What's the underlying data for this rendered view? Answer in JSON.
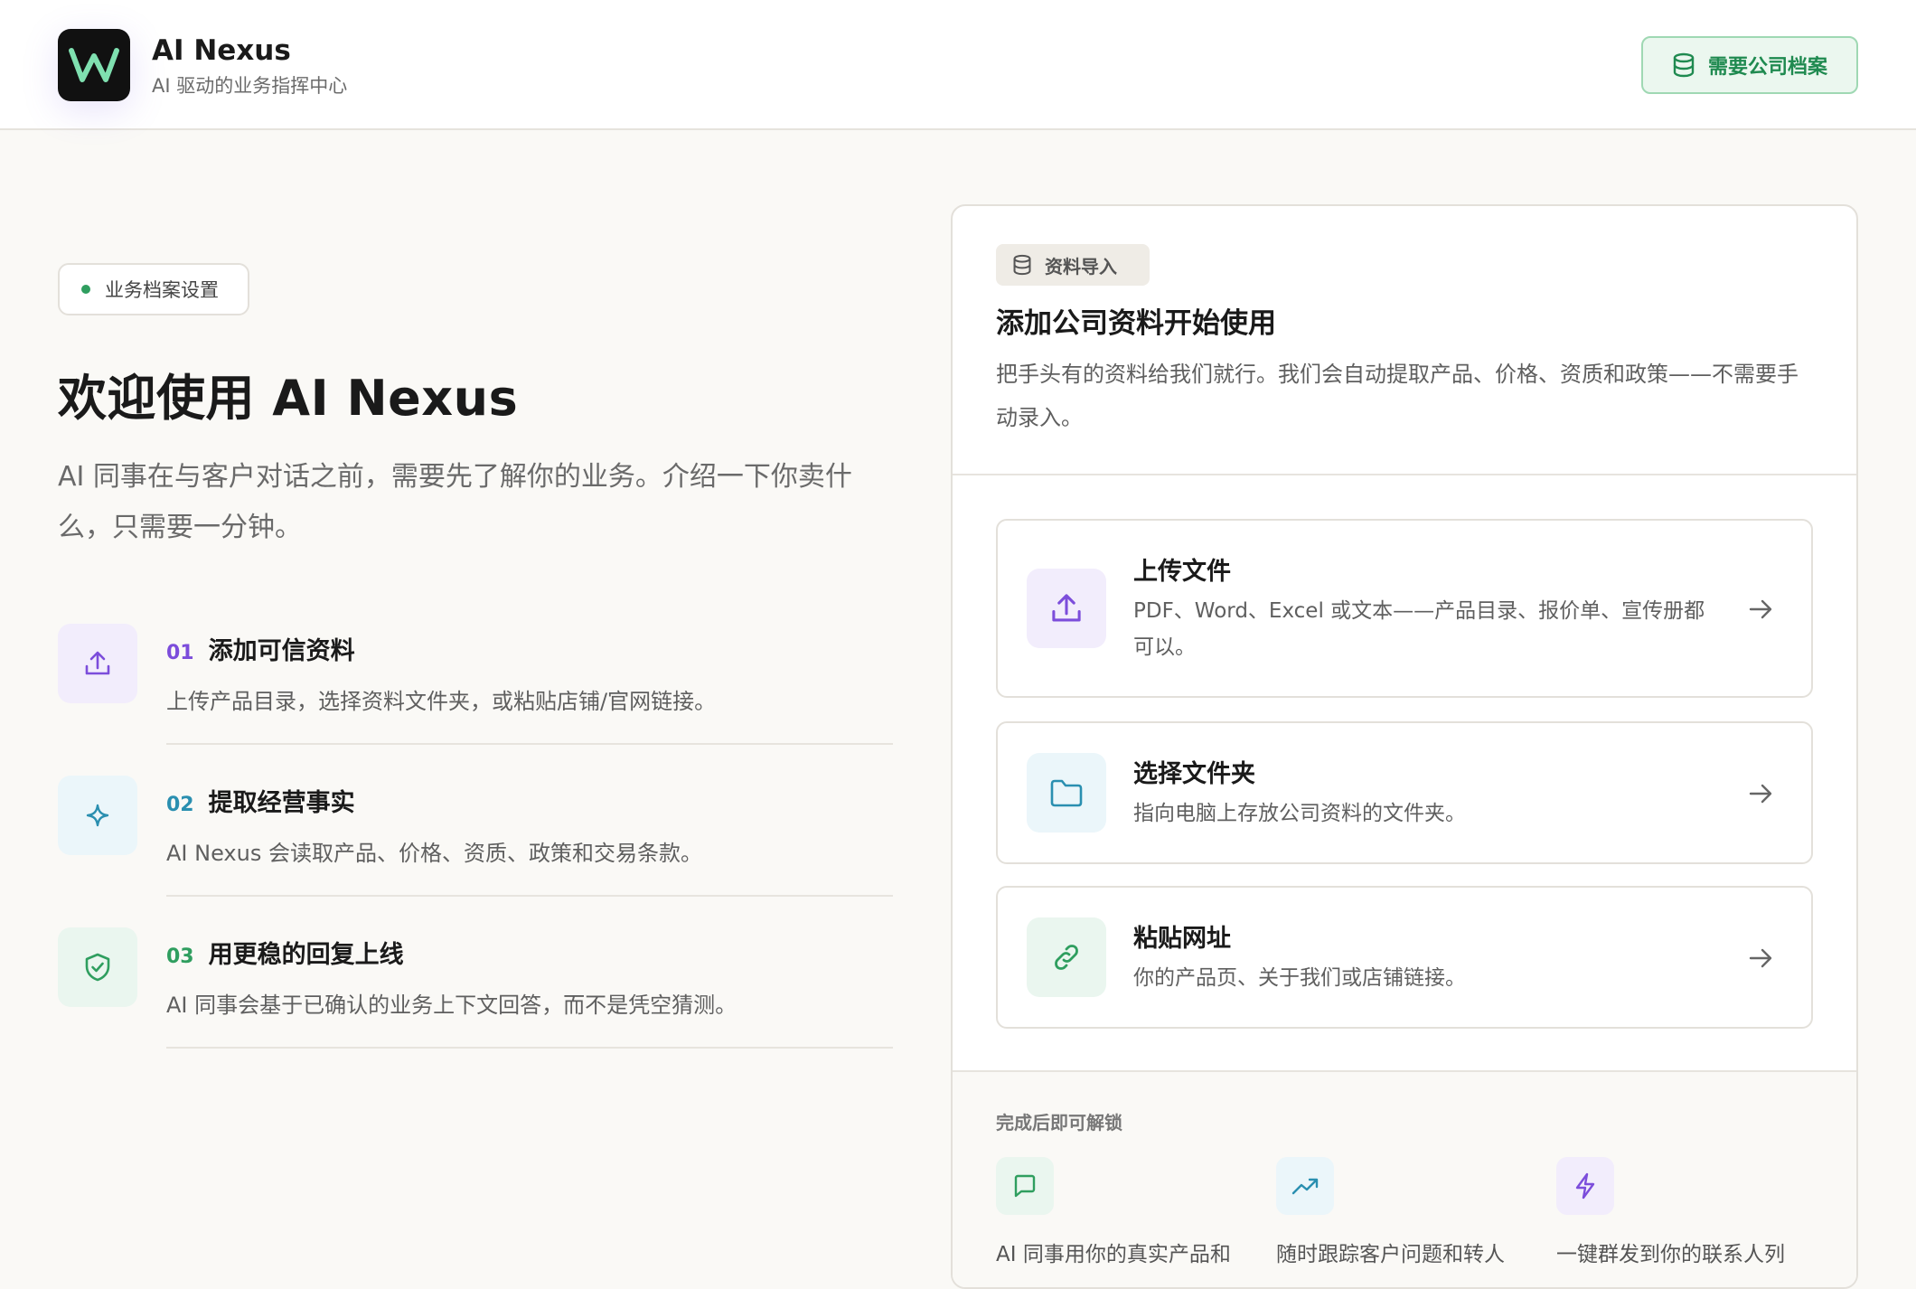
{
  "header": {
    "app_title": "AI Nexus",
    "app_subtitle": "AI 驱动的业务指挥中心",
    "profile_button": "需要公司档案"
  },
  "intro": {
    "badge": "业务档案设置",
    "title": "欢迎使用 AI Nexus",
    "description": "AI 同事在与客户对话之前，需要先了解你的业务。介绍一下你卖什么，只需要一分钟。"
  },
  "steps": [
    {
      "number": "01",
      "title": "添加可信资料",
      "description": "上传产品目录，选择资料文件夹，或粘贴店铺/官网链接。"
    },
    {
      "number": "02",
      "title": "提取经营事实",
      "description": "AI Nexus 会读取产品、价格、资质、政策和交易条款。"
    },
    {
      "number": "03",
      "title": "用更稳的回复上线",
      "description": "AI 同事会基于已确认的业务上下文回答，而不是凭空猜测。"
    }
  ],
  "import_card": {
    "tag": "资料导入",
    "title": "添加公司资料开始使用",
    "description": "把手头有的资料给我们就行。我们会自动提取产品、价格、资质和政策——不需要手动录入。",
    "options": [
      {
        "title": "上传文件",
        "description": "PDF、Word、Excel 或文本——产品目录、报价单、宣传册都可以。"
      },
      {
        "title": "选择文件夹",
        "description": "指向电脑上存放公司资料的文件夹。"
      },
      {
        "title": "粘贴网址",
        "description": "你的产品页、关于我们或店铺链接。"
      }
    ],
    "unlock": {
      "label": "完成后即可解锁",
      "items": [
        {
          "text": "AI 同事用你的真实产品和"
        },
        {
          "text": "随时跟踪客户问题和转人"
        },
        {
          "text": "一键群发到你的联系人列"
        }
      ]
    }
  },
  "colors": {
    "purple": "#7c4ddb",
    "teal": "#2a8fb0",
    "green": "#2f9e5f",
    "green_bg": "#ebf7ef"
  }
}
